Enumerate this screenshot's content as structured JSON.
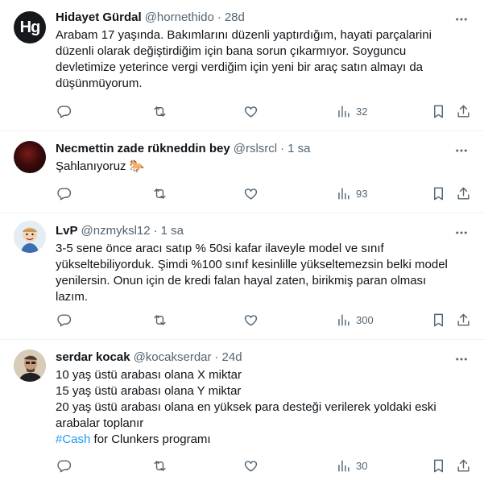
{
  "tweets": [
    {
      "avatar_text": "Hg",
      "name": "Hidayet Gürdal",
      "handle": "@hornethido",
      "time": "28d",
      "lines": [
        "Arabam 17 yaşında. Bakımlarını düzenli yaptırdığım, hayati parçalarini",
        "düzenli olarak değiştirdiğim için bana sorun çıkarmıyor. Soyguncu",
        "devletimize yeterince vergi verdiğim için yeni bir araç satın almayı da",
        "düşünmüyorum."
      ],
      "views": "32"
    },
    {
      "name": "Necmettin zade rükneddin bey",
      "handle": "@rslsrcl",
      "time": "1 sa",
      "lines": [
        "Şahlanıyoruz 🐎"
      ],
      "views": "93"
    },
    {
      "name": "LvP",
      "handle": "@nzmyksl12",
      "time": "1 sa",
      "lines": [
        "3-5 sene önce aracı satıp % 50si kafar ilaveyle model ve sınıf",
        "yükseltebiliyorduk. Şimdi %100 sınıf kesinlille yükseltemezsin belki model",
        "yenilersin. Onun için de kredi falan hayal zaten, birikmiş paran olması",
        "lazım."
      ],
      "views": "300"
    },
    {
      "name": "serdar kocak",
      "handle": "@kocakserdar",
      "time": "24d",
      "lines": [
        "10 yaş üstü arabası olana X miktar",
        "15 yaş üstü arabası olana Y miktar",
        "20 yaş üstü arabası olana en yüksek para desteği verilerek yoldaki eski",
        "arabalar toplanır"
      ],
      "hashtag": "#Cash",
      "last_line_rest": " for Clunkers programı",
      "views": "30"
    }
  ],
  "dot": "·",
  "colors": {
    "text": "#0f1419",
    "muted": "#536471",
    "link": "#1d9bf0",
    "border": "#eff3f4"
  },
  "icons": [
    "reply-icon",
    "retweet-icon",
    "like-icon",
    "views-icon",
    "bookmark-icon",
    "share-icon",
    "more-icon"
  ]
}
